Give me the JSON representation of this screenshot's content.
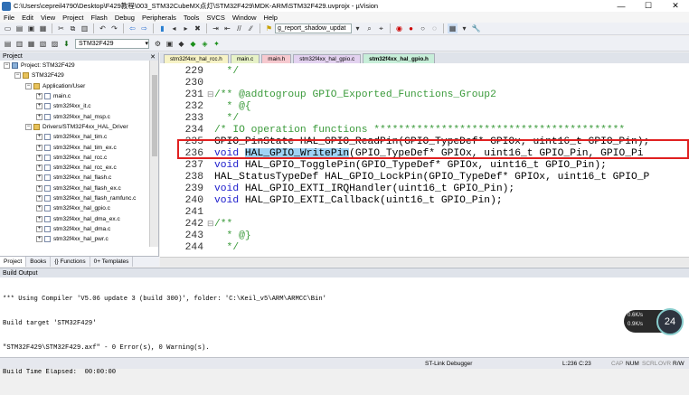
{
  "window": {
    "title": "C:\\Users\\cepreil4790\\Desktop\\F429教程\\003_STM32CubeMX点灯\\STM32F429\\MDK-ARM\\STM32F429.uvprojx - µVision",
    "minimize": "—",
    "maximize": "☐",
    "close": "✕"
  },
  "menu": [
    "File",
    "Edit",
    "View",
    "Project",
    "Flash",
    "Debug",
    "Peripherals",
    "Tools",
    "SVCS",
    "Window",
    "Help"
  ],
  "toolbar": {
    "find_value": "g_report_shadow_updat",
    "target": "STM32F429"
  },
  "project_panel": {
    "title": "Project",
    "close": "✕",
    "tree": [
      {
        "level": 0,
        "expander": "−",
        "icon": "project",
        "label": "Project: STM32F429"
      },
      {
        "level": 1,
        "expander": "−",
        "icon": "folder",
        "label": "STM32F429"
      },
      {
        "level": 2,
        "expander": "−",
        "icon": "folder",
        "label": "Application/User"
      },
      {
        "level": 3,
        "expander": "+",
        "icon": "file",
        "label": "main.c"
      },
      {
        "level": 3,
        "expander": "+",
        "icon": "file",
        "label": "stm32f4xx_it.c"
      },
      {
        "level": 3,
        "expander": "+",
        "icon": "file",
        "label": "stm32f4xx_hal_msp.c"
      },
      {
        "level": 2,
        "expander": "−",
        "icon": "folder",
        "label": "Drivers/STM32F4xx_HAL_Driver"
      },
      {
        "level": 3,
        "expander": "+",
        "icon": "file",
        "label": "stm32f4xx_hal_tim.c"
      },
      {
        "level": 3,
        "expander": "+",
        "icon": "file",
        "label": "stm32f4xx_hal_tim_ex.c"
      },
      {
        "level": 3,
        "expander": "+",
        "icon": "file",
        "label": "stm32f4xx_hal_rcc.c"
      },
      {
        "level": 3,
        "expander": "+",
        "icon": "file",
        "label": "stm32f4xx_hal_rcc_ex.c"
      },
      {
        "level": 3,
        "expander": "+",
        "icon": "file",
        "label": "stm32f4xx_hal_flash.c"
      },
      {
        "level": 3,
        "expander": "+",
        "icon": "file",
        "label": "stm32f4xx_hal_flash_ex.c"
      },
      {
        "level": 3,
        "expander": "+",
        "icon": "file",
        "label": "stm32f4xx_hal_flash_ramfunc.c"
      },
      {
        "level": 3,
        "expander": "+",
        "icon": "file",
        "label": "stm32f4xx_hal_gpio.c"
      },
      {
        "level": 3,
        "expander": "+",
        "icon": "file",
        "label": "stm32f4xx_hal_dma_ex.c"
      },
      {
        "level": 3,
        "expander": "+",
        "icon": "file",
        "label": "stm32f4xx_hal_dma.c"
      },
      {
        "level": 3,
        "expander": "+",
        "icon": "file",
        "label": "stm32f4xx_hal_pwr.c"
      }
    ],
    "tabs": [
      "Project",
      "Books",
      "{} Functions",
      "0+ Templates"
    ]
  },
  "editor": {
    "tabs": [
      {
        "label": "stm32f4xx_hal_rcc.h",
        "color": "#f7f3c6"
      },
      {
        "label": "main.c",
        "color": "#e7f2c7"
      },
      {
        "label": "main.h",
        "color": "#f6c9cf"
      },
      {
        "label": "stm32f4xx_hal_gpio.c",
        "color": "#e3d2f0"
      },
      {
        "label": "stm32f4xx_hal_gpio.h",
        "color": "#c7eed9",
        "active": true
      }
    ],
    "lines": [
      {
        "num": "229",
        "fold": "",
        "segments": [
          {
            "t": "  */",
            "c": "cm"
          }
        ]
      },
      {
        "num": "230",
        "fold": "",
        "segments": []
      },
      {
        "num": "231",
        "fold": "⊟",
        "segments": [
          {
            "t": "/** @addtogroup GPIO_Exported_Functions_Group2",
            "c": "cm"
          }
        ]
      },
      {
        "num": "232",
        "fold": "",
        "segments": [
          {
            "t": "  * @{",
            "c": "cm"
          }
        ]
      },
      {
        "num": "233",
        "fold": "",
        "segments": [
          {
            "t": "  */",
            "c": "cm"
          }
        ]
      },
      {
        "num": "234",
        "fold": "",
        "segments": [
          {
            "t": "/* IO operation functions *****************************************",
            "c": "cm"
          }
        ]
      },
      {
        "num": "235",
        "fold": "",
        "segments": [
          {
            "t": "GPIO_PinState HAL_GPIO_ReadPin(GPIO_TypeDef* GPIOx, uint16_t GPIO_Pin);",
            "c": ""
          }
        ]
      },
      {
        "num": "236",
        "fold": "",
        "segments": [
          {
            "t": "void",
            "c": "kw"
          },
          {
            "t": " ",
            "c": ""
          },
          {
            "t": "HAL_GPIO_WritePin",
            "c": "hl"
          },
          {
            "t": "(GPIO_TypeDef* GPIOx, uint16_t GPIO_Pin, GPIO_Pi",
            "c": ""
          }
        ]
      },
      {
        "num": "237",
        "fold": "",
        "segments": [
          {
            "t": "void",
            "c": "kw"
          },
          {
            "t": " HAL_GPIO_TogglePin(GPIO_TypeDef* GPIOx, uint16_t GPIO_Pin);",
            "c": ""
          }
        ]
      },
      {
        "num": "238",
        "fold": "",
        "segments": [
          {
            "t": "HAL_StatusTypeDef HAL_GPIO_LockPin(GPIO_TypeDef* GPIOx, uint16_t GPIO_P",
            "c": ""
          }
        ]
      },
      {
        "num": "239",
        "fold": "",
        "segments": [
          {
            "t": "void",
            "c": "kw"
          },
          {
            "t": " HAL_GPIO_EXTI_IRQHandler(uint16_t GPIO_Pin);",
            "c": ""
          }
        ]
      },
      {
        "num": "240",
        "fold": "",
        "segments": [
          {
            "t": "void",
            "c": "kw"
          },
          {
            "t": " HAL_GPIO_EXTI_Callback(uint16_t GPIO_Pin);",
            "c": ""
          }
        ]
      },
      {
        "num": "241",
        "fold": "",
        "segments": []
      },
      {
        "num": "242",
        "fold": "⊟",
        "segments": [
          {
            "t": "/**",
            "c": "cm"
          }
        ]
      },
      {
        "num": "243",
        "fold": "",
        "segments": [
          {
            "t": "  * @}",
            "c": "cm"
          }
        ]
      },
      {
        "num": "244",
        "fold": "",
        "segments": [
          {
            "t": "  */",
            "c": "cm"
          }
        ]
      }
    ]
  },
  "build_output": {
    "title": "Build Output",
    "lines": [
      "*** Using Compiler 'V5.06 update 3 (build 300)', folder: 'C:\\Keil_v5\\ARM\\ARMCC\\Bin'",
      "Build target 'STM32F429'",
      "\"STM32F429\\STM32F429.axf\" - 0 Error(s), 0 Warning(s).",
      "Build Time Elapsed:  00:00:00"
    ]
  },
  "network_widget": {
    "up": "0.6K/s",
    "down": "0.9K/s",
    "percent": "24"
  },
  "status_bar": {
    "debugger": "ST-Link Debugger",
    "position": "L:236 C:23",
    "caps": "CAP",
    "num": "NUM",
    "scrl": "SCRL",
    "ovr": "OVR",
    "rw": "R/W"
  }
}
